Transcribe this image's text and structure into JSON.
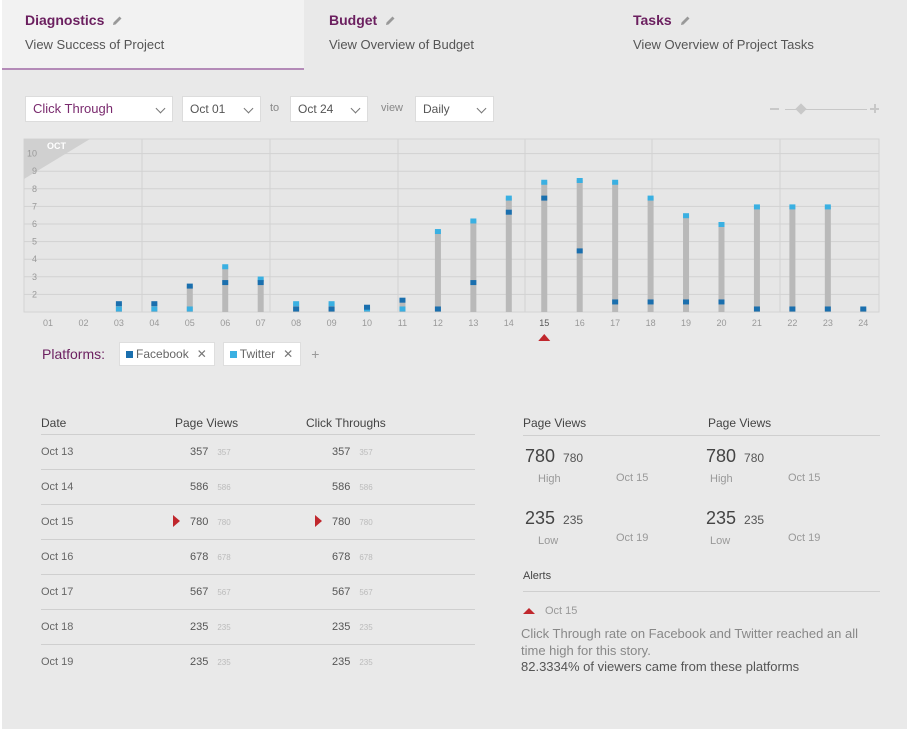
{
  "tabs": [
    {
      "title": "Diagnostics",
      "subtitle": "View Success of Project",
      "active": true
    },
    {
      "title": "Budget",
      "subtitle": "View Overview of Budget",
      "active": false
    },
    {
      "title": "Tasks",
      "subtitle": "View Overview of Project Tasks",
      "active": false
    }
  ],
  "toolbar": {
    "metric": "Click Through",
    "from": "Oct 01",
    "to_label": "to",
    "to": "Oct 24",
    "view_label": "view",
    "view": "Daily"
  },
  "colors": {
    "facebook": "#1a6fae",
    "twitter": "#3ab0e2",
    "bar": "#b9b9b9",
    "accent": "#6b1f5f",
    "alert": "#c0272d"
  },
  "chart_data": {
    "type": "bar",
    "month_label": "OCT",
    "categories": [
      "01",
      "02",
      "03",
      "04",
      "05",
      "06",
      "07",
      "08",
      "09",
      "10",
      "11",
      "12",
      "13",
      "14",
      "15",
      "16",
      "17",
      "18",
      "19",
      "20",
      "21",
      "22",
      "23",
      "24"
    ],
    "y_ticks": [
      "2",
      "3",
      "4",
      "5",
      "6",
      "7",
      "8",
      "9",
      "10"
    ],
    "ylim": [
      1,
      10
    ],
    "selected_category": "15",
    "series": [
      {
        "name": "total",
        "values": [
          null,
          null,
          1.5,
          1.5,
          2.5,
          3.6,
          2.9,
          1.5,
          1.5,
          1.3,
          1.7,
          5.6,
          6.2,
          7.5,
          8.4,
          8.5,
          8.4,
          7.5,
          6.5,
          6.0,
          7.0,
          7.0,
          7.0,
          1.2
        ]
      },
      {
        "name": "Facebook",
        "values": [
          null,
          null,
          1.5,
          1.5,
          2.5,
          2.7,
          2.7,
          1.2,
          1.2,
          1.3,
          1.7,
          1.2,
          2.7,
          6.7,
          7.5,
          4.5,
          1.6,
          1.6,
          1.6,
          1.6,
          1.2,
          1.2,
          1.2,
          1.2
        ]
      },
      {
        "name": "Twitter",
        "values": [
          null,
          null,
          1.2,
          1.2,
          1.2,
          3.6,
          2.9,
          1.5,
          1.5,
          1.2,
          1.2,
          5.6,
          6.2,
          7.5,
          8.4,
          8.5,
          8.4,
          7.5,
          6.5,
          6.0,
          7.0,
          7.0,
          7.0,
          null
        ]
      }
    ]
  },
  "platforms": {
    "label": "Platforms:",
    "items": [
      {
        "name": "Facebook",
        "color": "#1a6fae"
      },
      {
        "name": "Twitter",
        "color": "#3ab0e2"
      }
    ],
    "add": "+"
  },
  "table": {
    "headers": {
      "date": "Date",
      "page_views": "Page Views",
      "click_throughs": "Click Throughs"
    },
    "rows": [
      {
        "date": "Oct 13",
        "page_views": "357",
        "page_views_small": "357",
        "click_throughs": "357",
        "click_throughs_small": "357",
        "highlight": false
      },
      {
        "date": "Oct 14",
        "page_views": "586",
        "page_views_small": "586",
        "click_throughs": "586",
        "click_throughs_small": "586",
        "highlight": false
      },
      {
        "date": "Oct 15",
        "page_views": "780",
        "page_views_small": "780",
        "click_throughs": "780",
        "click_throughs_small": "780",
        "highlight": true
      },
      {
        "date": "Oct 16",
        "page_views": "678",
        "page_views_small": "678",
        "click_throughs": "678",
        "click_throughs_small": "678",
        "highlight": false
      },
      {
        "date": "Oct 17",
        "page_views": "567",
        "page_views_small": "567",
        "click_throughs": "567",
        "click_throughs_small": "567",
        "highlight": false
      },
      {
        "date": "Oct 18",
        "page_views": "235",
        "page_views_small": "235",
        "click_throughs": "235",
        "click_throughs_small": "235",
        "highlight": false
      },
      {
        "date": "Oct 19",
        "page_views": "235",
        "page_views_small": "235",
        "click_throughs": "235",
        "click_throughs_small": "235",
        "highlight": false
      }
    ]
  },
  "stats": {
    "columns": [
      {
        "title": "Page Views",
        "high": "780",
        "high_small": "780",
        "high_label": "High",
        "high_date": "Oct 15",
        "low": "235",
        "low_small": "235",
        "low_label": "Low",
        "low_date": "Oct 19"
      },
      {
        "title": "Page Views",
        "high": "780",
        "high_small": "780",
        "high_label": "High",
        "high_date": "Oct 15",
        "low": "235",
        "low_small": "235",
        "low_label": "Low",
        "low_date": "Oct 19"
      }
    ]
  },
  "alerts": {
    "title": "Alerts",
    "date": "Oct 15",
    "text": "Click Through rate on Facebook and Twitter reached an all time high for this story.",
    "percent": "82.3334% of viewers came from these platforms"
  }
}
